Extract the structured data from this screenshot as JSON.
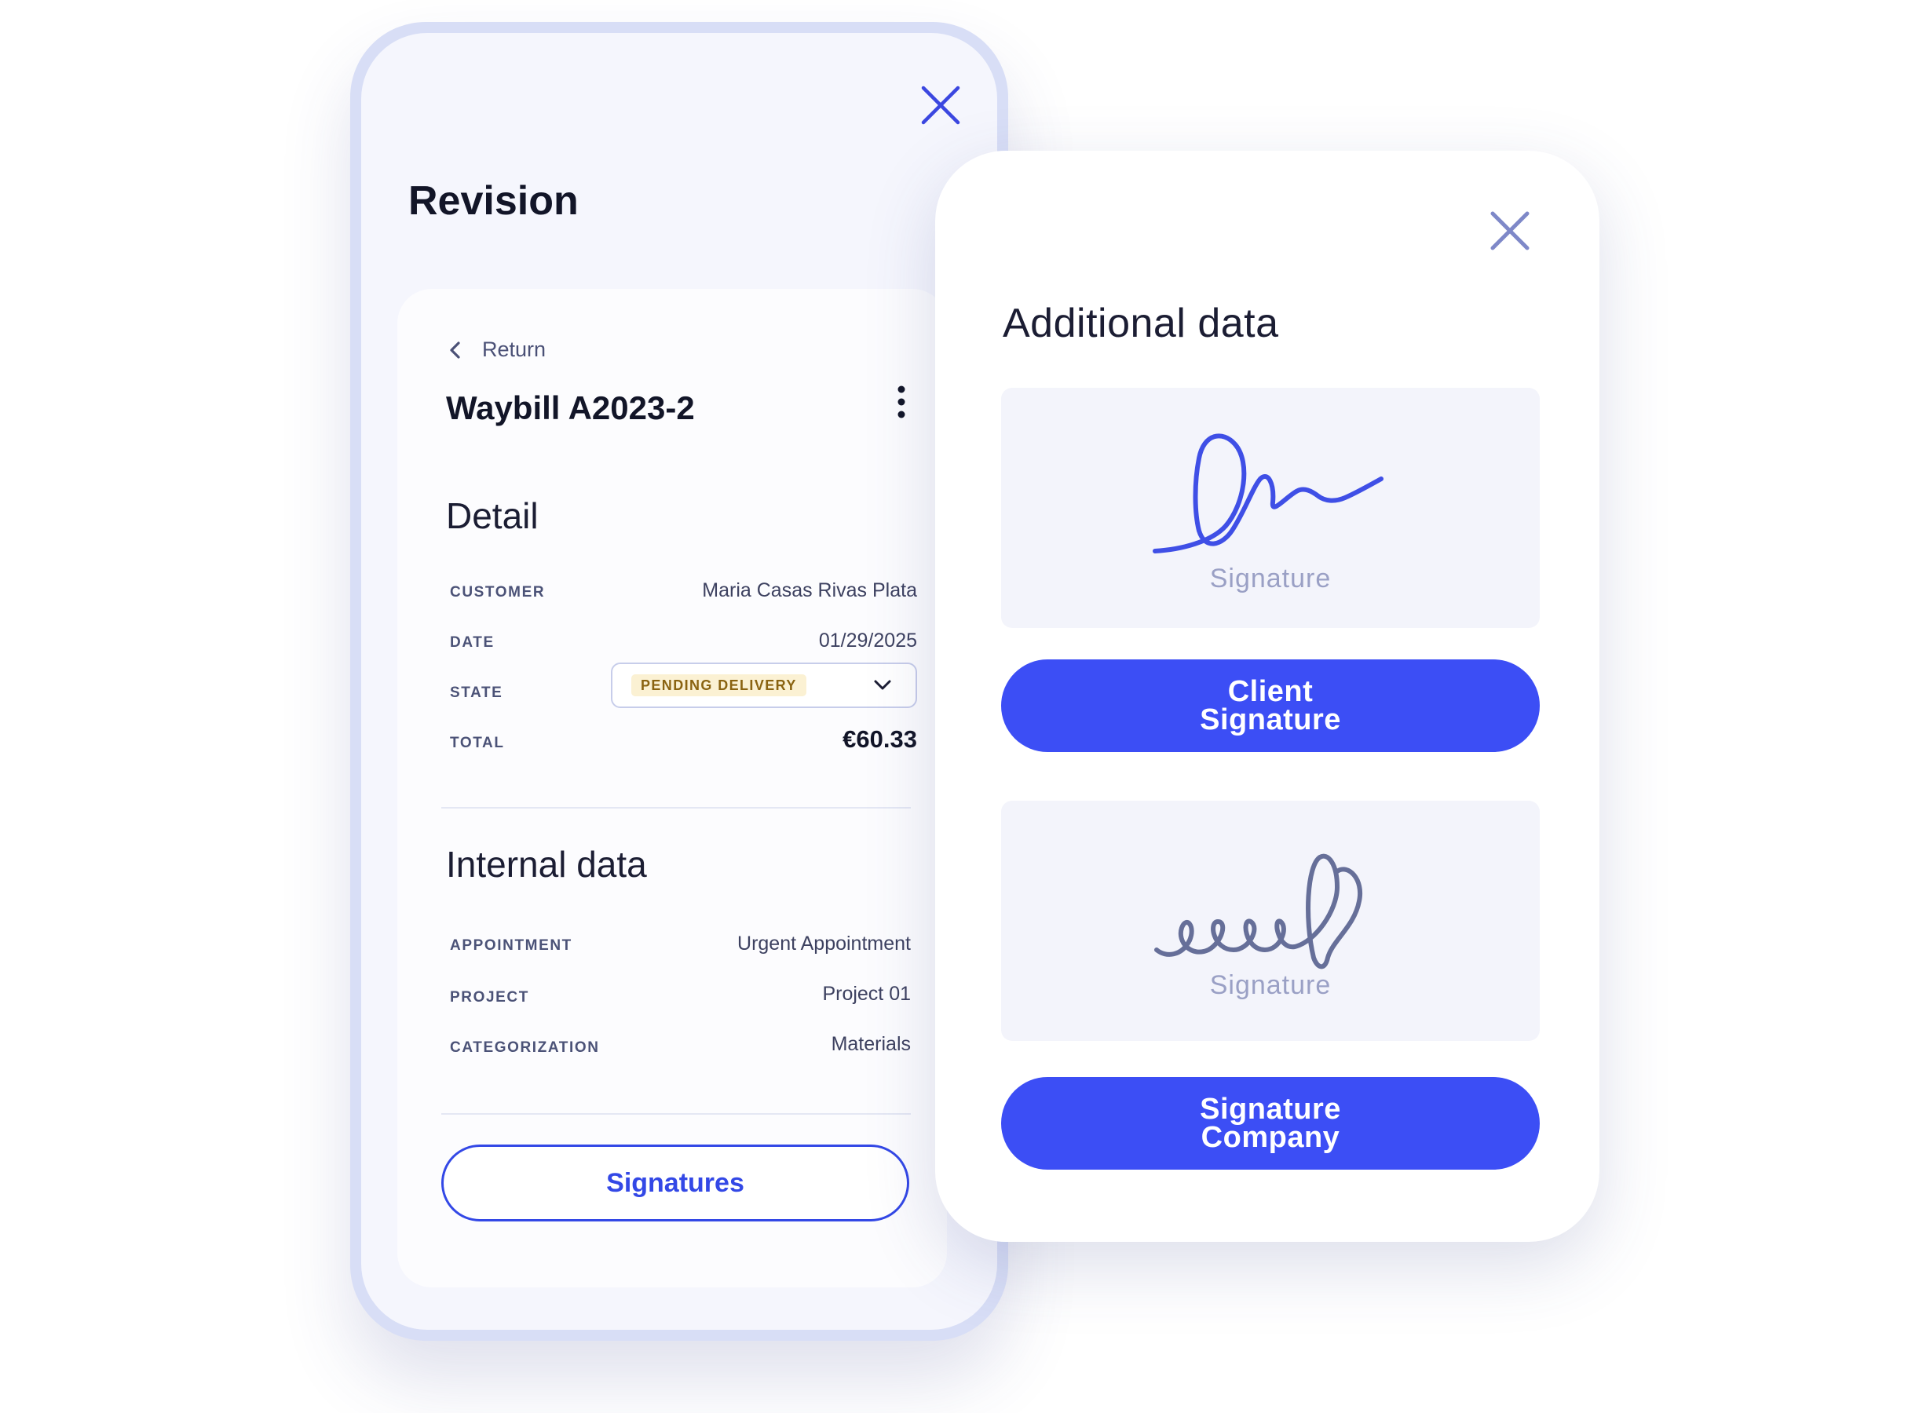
{
  "revision": {
    "title": "Revision",
    "return_label": "Return",
    "waybill_title": "Waybill A2023-2",
    "detail": {
      "section_title": "Detail",
      "customer_label": "CUSTOMER",
      "customer_value": "Maria Casas Rivas Plata",
      "date_label": "DATE",
      "date_value": "01/29/2025",
      "state_label": "STATE",
      "state_value": "PENDING DELIVERY",
      "total_label": "TOTAL",
      "total_value": "€60.33"
    },
    "internal": {
      "section_title": "Internal data",
      "appointment_label": "APPOINTMENT",
      "appointment_value": "Urgent Appointment",
      "project_label": "PROJECT",
      "project_value": "Project 01",
      "categorization_label": "CATEGORIZATION",
      "categorization_value": "Materials"
    },
    "signatures_button": "Signatures"
  },
  "additional": {
    "title": "Additional data",
    "client_signature_placeholder": "Signature",
    "client_signature_button": "Client Signature",
    "company_signature_placeholder": "Signature",
    "company_signature_button": "Signature Company"
  },
  "icons": {
    "close": "close-icon",
    "back": "chevron-left-icon",
    "more": "more-vertical-icon",
    "dropdown": "chevron-down-icon"
  },
  "colors": {
    "accent": "#3c4ef5",
    "client_signature_ink": "#3f4fe6",
    "company_signature_ink": "#666f99",
    "pending_badge_bg": "#fbf1d3",
    "pending_badge_text": "#8a6311"
  }
}
